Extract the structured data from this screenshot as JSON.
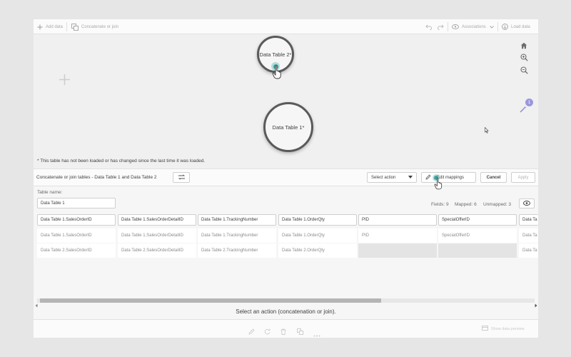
{
  "toolbar": {
    "add_data": "Add data",
    "concatenate_or_join": "Concatenate or join",
    "associations": "Associations",
    "load_data": "Load data"
  },
  "canvas": {
    "bubble_top": "Data Table 2*",
    "bubble_center": "Data Table 1*",
    "badge_count": "1",
    "note": "* This table has not been loaded or has changed since the last time it was loaded."
  },
  "panel": {
    "title": "Concatenate or join tables - Data Table 1 and Data Table 2",
    "select_action": "Select action",
    "edit_mappings": "Edit mappings",
    "cancel": "Cancel",
    "apply": "Apply"
  },
  "form": {
    "table_name_label": "Table name:",
    "table_name_value": "Data Table 1",
    "fields": "Fields: 9",
    "mapped": "Mapped: 6",
    "unmapped": "Unmapped: 3"
  },
  "columns": [
    {
      "header": "Data Table 1.SalesOrderID",
      "row1": "Data Table 1.SalesOrderID",
      "row2": "Data Table 2.SalesOrderID"
    },
    {
      "header": "Data Table 1.SalesOrderDetailID",
      "row1": "Data Table 1.SalesOrderDetailID",
      "row2": "Data Table 2.SalesOrderDetailID"
    },
    {
      "header": "Data Table 1.TrackingNumber",
      "row1": "Data Table 1.TrackingNumber",
      "row2": "Data Table 2.TrackingNumber"
    },
    {
      "header": "Data Table 1.OrderQty",
      "row1": "Data Table 1.OrderQty",
      "row2": "Data Table 2.OrderQty"
    },
    {
      "header": "PID",
      "row1": "PID",
      "row2": ""
    },
    {
      "header": "SpecialOfferID",
      "row1": "SpecialOfferID",
      "row2": ""
    },
    {
      "header": "Data Ta",
      "row1": "Data Ta",
      "row2": "Data Ta"
    }
  ],
  "status": "Select an action (concatenation or join).",
  "footer": {
    "show_data_preview": "Show data preview"
  },
  "colors": {
    "accent": "#3aa5a0",
    "border": "#cfcfcf",
    "empty_cell": "#e4e4e4"
  }
}
